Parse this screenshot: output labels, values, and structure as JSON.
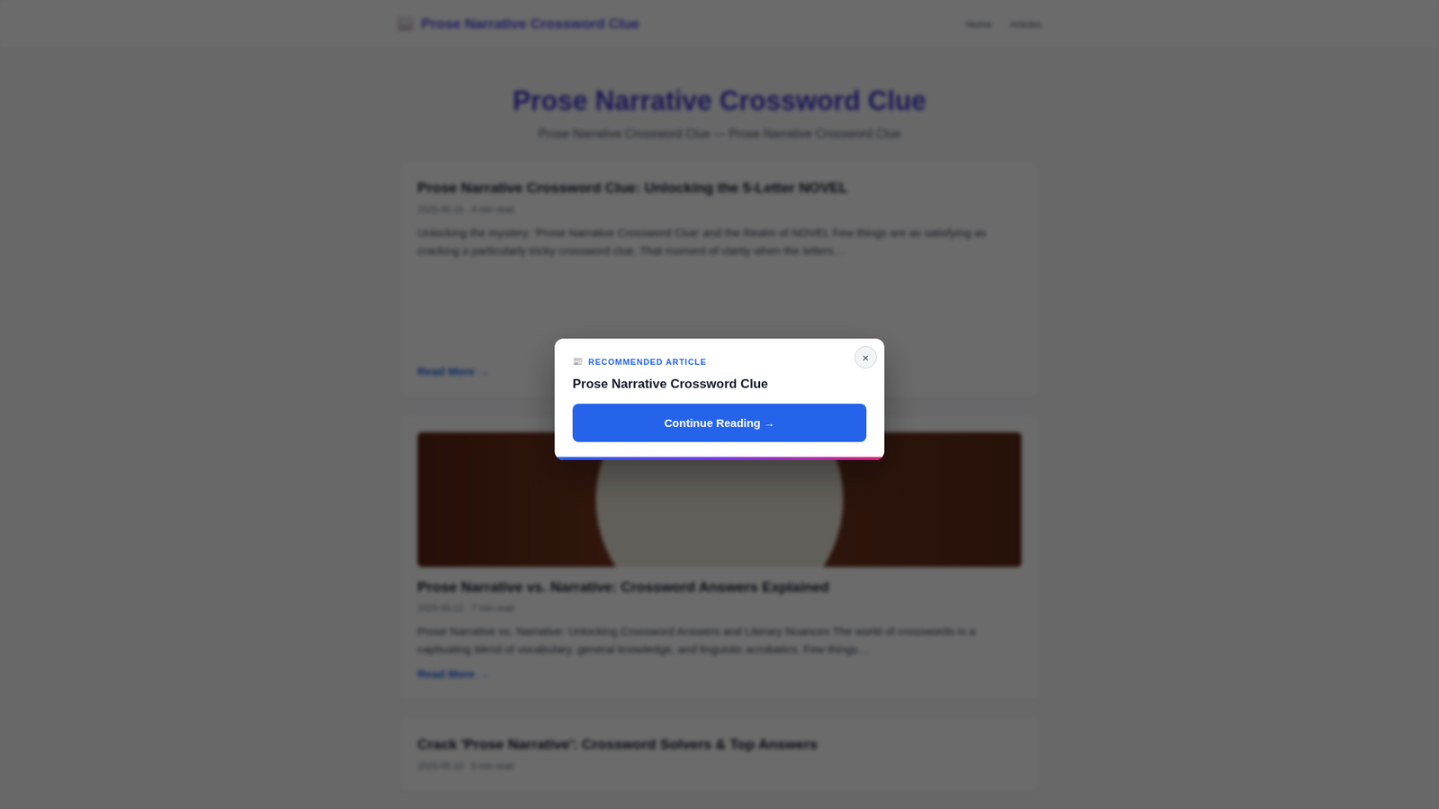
{
  "site": {
    "logo_icon": "📖",
    "name": "Prose Narrative Crossword Clue"
  },
  "nav": [
    {
      "label": "Home"
    },
    {
      "label": "Articles"
    }
  ],
  "hero": {
    "title": "Prose Narrative Crossword Clue",
    "subtitle": "Prose Narrative Crossword Clue — Prose Narrative Crossword Clue"
  },
  "articles": [
    {
      "kind": "placeholder",
      "title": "Prose Narrative Crossword Clue: Unlocking the 5-Letter NOVEL",
      "date": "2025-05-15 · 4 min read",
      "excerpt": "Unlocking the mystery: 'Prose Narrative Crossword Clue' and the Realm of NOVEL Few things are as satisfying as cracking a particularly tricky crossword clue. That moment of clarity when the letters…",
      "read_more": "Read More →"
    },
    {
      "kind": "photo",
      "title": "Prose Narrative vs. Narrative: Crossword Answers Explained",
      "date": "2025-05-12 · 7 min read",
      "excerpt": "Prose Narrative vs. Narrative: Unlocking Crossword Answers and Literary Nuances The world of crosswords is a captivating blend of vocabulary, general knowledge, and linguistic acrobatics. Few things…",
      "read_more": "Read More →"
    },
    {
      "kind": "text",
      "title": "Crack 'Prose Narrative': Crossword Solvers & Top Answers",
      "date": "2025-05-10 · 5 min read",
      "excerpt": "",
      "read_more": ""
    }
  ],
  "modal": {
    "icon": "📰",
    "label": "RECOMMENDED ARTICLE",
    "title": "Prose Narrative Crossword Clue",
    "button": "Continue Reading →",
    "close": "×"
  }
}
